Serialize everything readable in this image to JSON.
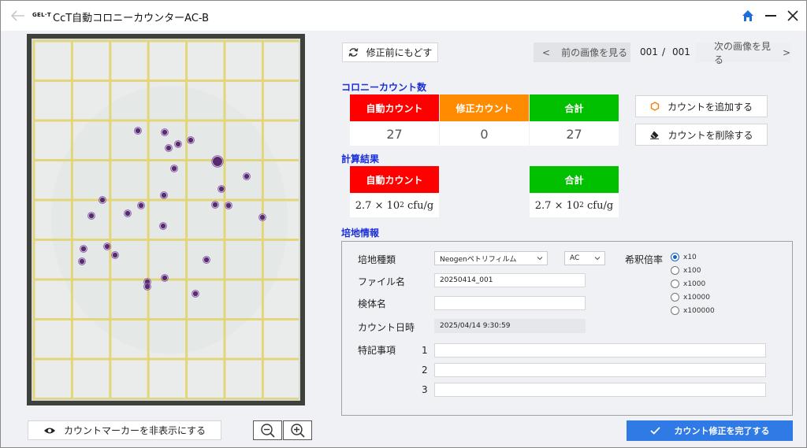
{
  "app": {
    "logo_text": "GEL·T",
    "title": "CcT自動コロニーカウンターAC-B"
  },
  "toolbar": {
    "revert_label": "修正前にもどす",
    "prev_label": "前の画像を見る",
    "prev_chevron": "<",
    "next_label": "次の画像を見る",
    "next_chevron": ">",
    "page_current": "001",
    "page_sep": "/",
    "page_total": "001"
  },
  "colony_count": {
    "title": "コロニーカウント数",
    "headers": {
      "auto": "自動カウント",
      "corrected": "修正カウント",
      "total": "合計"
    },
    "values": {
      "auto": "27",
      "corrected": "0",
      "total": "27"
    },
    "colors": {
      "auto": "#ff0000",
      "corrected": "#ff8c00",
      "total": "#00c000"
    }
  },
  "actions": {
    "add_label": "カウントを追加する",
    "delete_label": "カウントを削除する"
  },
  "calc_result": {
    "title": "計算結果",
    "auto_header": "自動カウント",
    "total_header": "合計",
    "auto_value": {
      "mantissa": "2.7 × 10",
      "exponent": "2",
      "unit": "cfu/g"
    },
    "total_value": {
      "mantissa": "2.7 × 10",
      "exponent": "2",
      "unit": "cfu/g"
    }
  },
  "medium_info": {
    "title": "培地情報",
    "type_label": "培地種類",
    "type_value": "Neogenペトリフィルム",
    "subtype_value": "AC",
    "dilution_label": "希釈倍率",
    "dilution_options": [
      "x10",
      "x100",
      "x1000",
      "x10000",
      "x100000"
    ],
    "dilution_selected": "x10",
    "file_label": "ファイル名",
    "file_value": "20250414_001",
    "sample_label": "検体名",
    "sample_value": "",
    "datetime_label": "カウント日時",
    "datetime_value": "2025/04/14 9:30:59",
    "notes_label": "特記事項",
    "notes": [
      {
        "num": "1",
        "value": ""
      },
      {
        "num": "2",
        "value": ""
      },
      {
        "num": "3",
        "value": ""
      }
    ]
  },
  "bottom": {
    "toggle_markers_label": "カウントマーカーを非表示にする",
    "finish_label": "カウント修正を完了する"
  },
  "icons": {
    "back": "arrow-left-icon",
    "home": "home-icon",
    "minimize": "minimize-icon",
    "close": "close-icon",
    "revert": "refresh-icon",
    "add": "hexagon-icon",
    "delete": "eraser-icon",
    "eye": "eye-icon",
    "zoom_out": "zoom-out-icon",
    "zoom_in": "zoom-in-icon",
    "check": "check-icon"
  }
}
